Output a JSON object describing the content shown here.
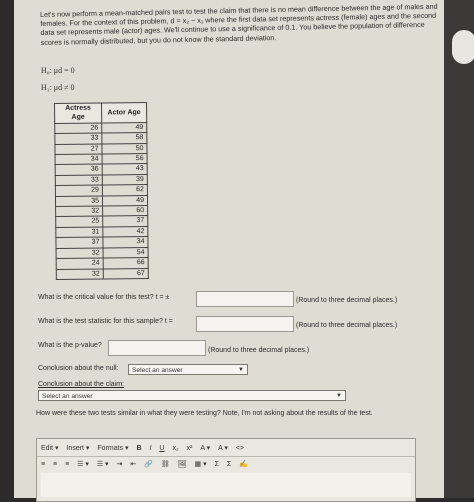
{
  "intro_text": "Let's now perform a mean-matched pairs test to test the claim that there is no mean difference between the age of males and females. For the context of this problem, d = x₂ − x₁ where the first data set represents actress (female) ages and the second data set represents male (actor) ages. We'll continue to use a significance of 0.1. You believe the population of difference scores is normally distributed, but you do not know the standard deviation.",
  "hypotheses": {
    "h0": "H₀: μd = 0",
    "h1": "H₁: μd ≠ 0"
  },
  "table": {
    "headers": [
      "Actress Age",
      "Actor Age"
    ],
    "rows": [
      [
        "26",
        "49"
      ],
      [
        "33",
        "58"
      ],
      [
        "27",
        "50"
      ],
      [
        "34",
        "56"
      ],
      [
        "36",
        "43"
      ],
      [
        "33",
        "39"
      ],
      [
        "29",
        "62"
      ],
      [
        "35",
        "49"
      ],
      [
        "32",
        "60"
      ],
      [
        "25",
        "37"
      ],
      [
        "31",
        "42"
      ],
      [
        "37",
        "34"
      ],
      [
        "32",
        "54"
      ],
      [
        "24",
        "66"
      ],
      [
        "32",
        "67"
      ]
    ]
  },
  "questions": {
    "critical": {
      "label": "What is the critical value for this test? t = ±",
      "hint": "(Round to three decimal places.)"
    },
    "statistic": {
      "label": "What is the test statistic for this sample? t =",
      "hint": "(Round to three decimal places.)"
    },
    "pvalue": {
      "label": "What is the p-value?",
      "hint": "(Round to three decimal places.)"
    },
    "null_conclusion": {
      "label": "Conclusion about the null:",
      "selected": "Select an answer"
    },
    "claim_conclusion": {
      "label": "Conclusion about the claim:",
      "selected": "Select an answer"
    },
    "similar": {
      "label": "How were these two tests similar in what they were testing? Note, I'm not asking about the results of the test."
    }
  },
  "editor": {
    "menus": [
      "Edit ▾",
      "Insert ▾",
      "Formats ▾"
    ],
    "format_buttons": [
      "B",
      "I",
      "U",
      "x₂",
      "x²",
      "A ▾",
      "A ▾",
      "<>"
    ],
    "row2": [
      "≡",
      "≡",
      "≡",
      "☰ ▾",
      "☰ ▾",
      "⇥",
      "⇤",
      "🔗",
      "⛓",
      "🖼",
      "▦ ▾",
      "Σ",
      "Σ",
      "✍"
    ]
  }
}
